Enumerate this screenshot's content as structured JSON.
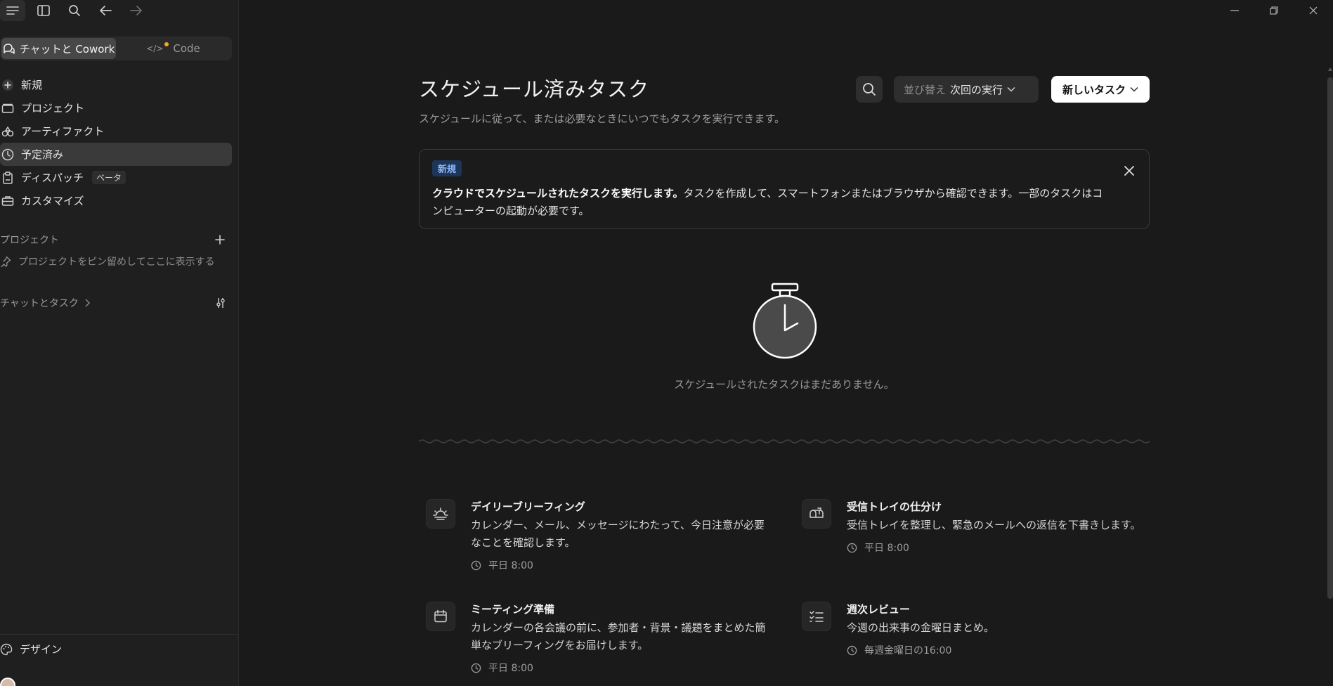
{
  "topbar": {
    "menu_icon": "menu-icon",
    "sidebar_icon": "sidebar-toggle-icon",
    "search_icon": "search-icon",
    "back_icon": "arrow-left-icon",
    "forward_icon": "arrow-right-icon"
  },
  "modes": {
    "chat_cowork": "チャットと Cowork",
    "code": "Code"
  },
  "sidebar": {
    "items": [
      {
        "label": "新規",
        "icon": "plus-circle-icon"
      },
      {
        "label": "プロジェクト",
        "icon": "folder-icon"
      },
      {
        "label": "アーティファクト",
        "icon": "artifacts-icon"
      },
      {
        "label": "予定済み",
        "icon": "clock-icon"
      },
      {
        "label": "ディスパッチ",
        "icon": "clipboard-icon",
        "badge": "ベータ"
      },
      {
        "label": "カスタマイズ",
        "icon": "briefcase-icon"
      }
    ],
    "projects_heading": "プロジェクト",
    "pin_hint": "プロジェクトをピン留めしてここに表示する",
    "chats_heading": "チャットとタスク",
    "design_label": "デザイン"
  },
  "main": {
    "title": "スケジュール済みタスク",
    "subtitle": "スケジュールに従って、または必要なときにいつでもタスクを実行できます。",
    "sort_label": "並び替え",
    "sort_value": "次回の実行",
    "new_task_label": "新しいタスク",
    "banner": {
      "tag": "新規",
      "bold": "クラウドでスケジュールされたタスクを実行します。",
      "rest": "タスクを作成して、スマートフォンまたはブラウザから確認できます。一部のタスクはコンピューターの起動が必要です。"
    },
    "empty_text": "スケジュールされたタスクはまだありません。",
    "templates": [
      {
        "title": "デイリーブリーフィング",
        "desc": "カレンダー、メール、メッセージにわたって、今日注意が必要なことを確認します。",
        "schedule": "平日 8:00",
        "icon": "sunrise-icon"
      },
      {
        "title": "受信トレイの仕分け",
        "desc": "受信トレイを整理し、緊急のメールへの返信を下書きします。",
        "schedule": "平日 8:00",
        "icon": "mailbox-icon"
      },
      {
        "title": "ミーティング準備",
        "desc": "カレンダーの各会議の前に、参加者・背景・議題をまとめた簡単なブリーフィングをお届けします。",
        "schedule": "平日 8:00",
        "icon": "calendar-icon"
      },
      {
        "title": "週次レビュー",
        "desc": "今週の出来事の金曜日まとめ。",
        "schedule": "毎週金曜日の16:00",
        "icon": "checklist-icon"
      }
    ]
  },
  "colors": {
    "background": "#1a1a1a",
    "sidebar": "#1f1f1f",
    "accent_dot": "#f5a623",
    "tag_bg": "#1d3557",
    "tag_text": "#8ab4f8"
  }
}
